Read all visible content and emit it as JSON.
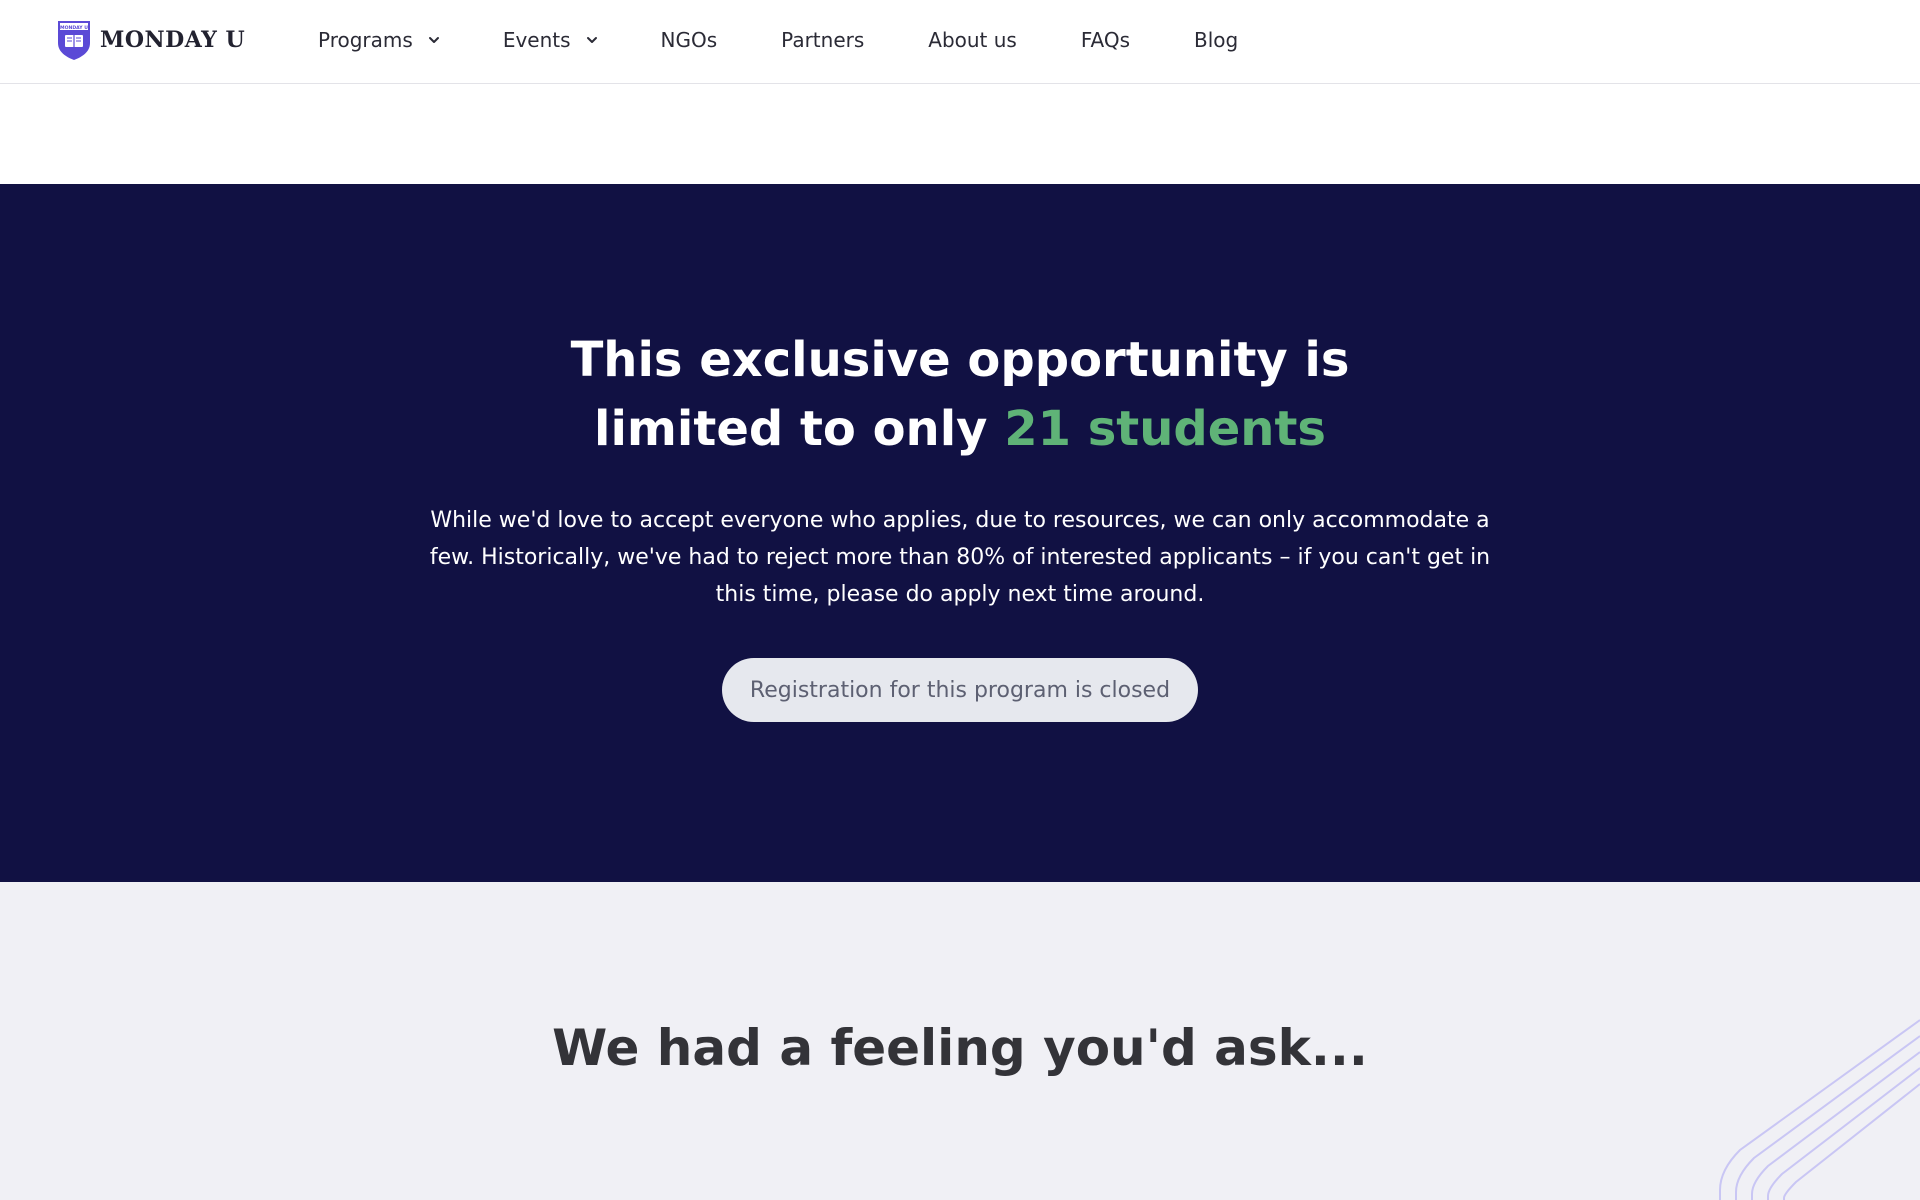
{
  "brand": {
    "name": "MONDAY U",
    "shield_text": "MONDAY U",
    "color": "#5b4ad6"
  },
  "nav": {
    "items": [
      {
        "label": "Programs",
        "dropdown": true,
        "icon": "chevron-down-icon"
      },
      {
        "label": "Events",
        "dropdown": true,
        "icon": "chevron-down-icon"
      },
      {
        "label": "NGOs",
        "dropdown": false
      },
      {
        "label": "Partners",
        "dropdown": false
      },
      {
        "label": "About us",
        "dropdown": false
      },
      {
        "label": "FAQs",
        "dropdown": false
      },
      {
        "label": "Blog",
        "dropdown": false
      }
    ]
  },
  "hero": {
    "title_line1": "This exclusive opportunity is",
    "title_line2_prefix": "limited to only ",
    "title_highlight": "21 students",
    "body": "While we'd love to accept everyone who applies, due to resources, we can only accommodate a few. Historically, we've had to reject more than 80% of interested applicants – if you can't get in this time, please do apply next time around.",
    "cta_label": "Registration for this program is closed",
    "background_color": "#111143",
    "highlight_color": "#5fb377"
  },
  "faq": {
    "title": "We had a feeling you'd ask...",
    "background_color": "#f0f0f5",
    "decoration": "diagonal-lines-decoration"
  }
}
